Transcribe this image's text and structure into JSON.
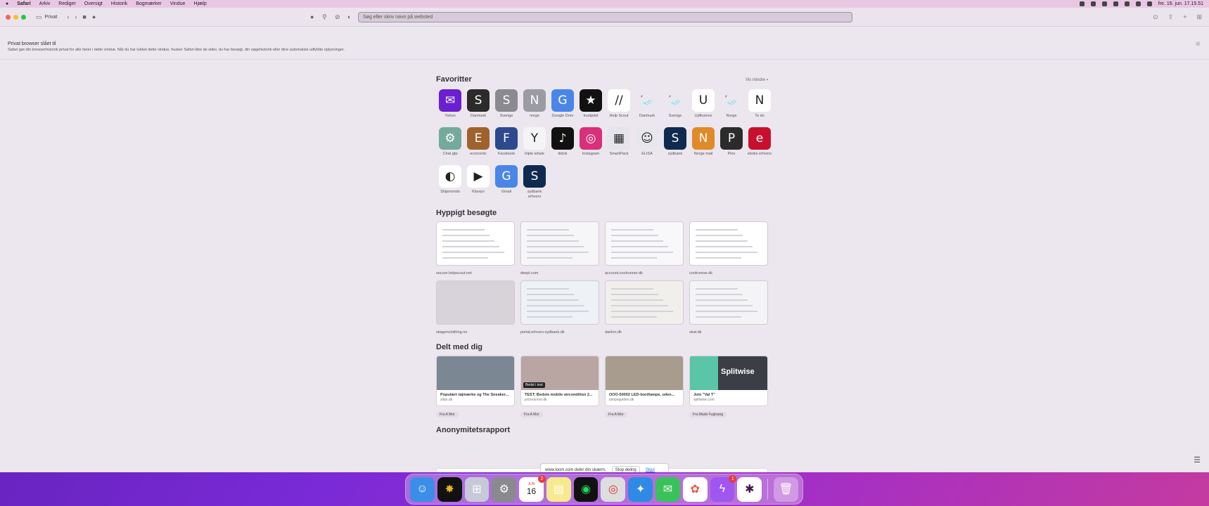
{
  "menubar": {
    "items": [
      "Safari",
      "Arkiv",
      "Rediger",
      "Oversigt",
      "Historik",
      "Bogmærker",
      "Vindue",
      "Hjælp"
    ],
    "clock": "fre. 16. jun. 17.15.51"
  },
  "toolbar": {
    "tab_label": "Privat",
    "address_placeholder": "Søg eller skriv navn på websted"
  },
  "private_banner": {
    "title": "Privat browser slået til",
    "text": "Safari gør din browserhistorik privat for alle faner i dette vindue. Når du har lukket dette vindue, husker Safari ikke de sider, du har besøgt, din søgehistorik eller dine automatisk udfyldte oplysninger."
  },
  "favorites": {
    "title": "Favoritter",
    "show_less": "Vis mindre",
    "items": [
      {
        "label": "Yahoo",
        "glyph": "✉",
        "color": "#6a1fd0"
      },
      {
        "label": "Danmark",
        "glyph": "S",
        "color": "#2b2b2b"
      },
      {
        "label": "Sverige",
        "glyph": "S",
        "color": "#8a8a90"
      },
      {
        "label": "norge",
        "glyph": "N",
        "color": "#9b9ba3"
      },
      {
        "label": "Google Drev",
        "glyph": "G",
        "color": "#4a86e8"
      },
      {
        "label": "trustpilot",
        "glyph": "★",
        "color": "#111111"
      },
      {
        "label": "Help Scout",
        "glyph": "//",
        "color": "#ffffff"
      },
      {
        "label": "Danmark",
        "glyph": "🦢",
        "color": "#ece6ee"
      },
      {
        "label": "Sverige",
        "glyph": "🦢",
        "color": "#ece6ee"
      },
      {
        "label": "Upfluence",
        "glyph": "U",
        "color": "#ffffff"
      },
      {
        "label": "Norge",
        "glyph": "🦢",
        "color": "#ece6ee"
      },
      {
        "label": "To do",
        "glyph": "N",
        "color": "#ffffff"
      },
      {
        "label": "Chat gtp",
        "glyph": "⚙",
        "color": "#74aa9c"
      },
      {
        "label": "economic",
        "glyph": "E",
        "color": "#a0622d"
      },
      {
        "label": "Facebook",
        "glyph": "F",
        "color": "#2c4a8c"
      },
      {
        "label": "triple whale",
        "glyph": "Y",
        "color": "#f4f4f6"
      },
      {
        "label": "tiktok",
        "glyph": "♪",
        "color": "#111111"
      },
      {
        "label": "Instagram",
        "glyph": "◎",
        "color": "#d8307a"
      },
      {
        "label": "SmartPack",
        "glyph": "▦",
        "color": "#e4e4ea"
      },
      {
        "label": "ELISA",
        "glyph": "☺",
        "color": "#e8e8ec"
      },
      {
        "label": "sydbank",
        "glyph": "S",
        "color": "#0e2a4e"
      },
      {
        "label": "Norge mail",
        "glyph": "N",
        "color": "#e08a2a"
      },
      {
        "label": "Ples",
        "glyph": "P",
        "color": "#2b2b2b"
      },
      {
        "label": "eboks erhverv",
        "glyph": "e",
        "color": "#c8102e"
      },
      {
        "label": "Shipmondo",
        "glyph": "◐",
        "color": "#ffffff"
      },
      {
        "label": "Klaviyo",
        "glyph": "▶",
        "color": "#ffffff"
      },
      {
        "label": "Gmail",
        "glyph": "G",
        "color": "#4a86e8"
      },
      {
        "label": "sydbank erhverv",
        "glyph": "S",
        "color": "#0e2a4e"
      }
    ]
  },
  "frequent": {
    "title": "Hyppigt besøgte",
    "items": [
      {
        "label": "secure.helpscout.net",
        "bg": "#ffffff"
      },
      {
        "label": "deepl.com",
        "bg": "#f6f6f8"
      },
      {
        "label": "account.coolrunner.dk",
        "bg": "#f8f8fa"
      },
      {
        "label": "coolrunner.dk",
        "bg": "#ffffff"
      },
      {
        "label": "skagenclothing.no",
        "bg": "#d7d3d8"
      },
      {
        "label": "portal.erhverv.sydbank.dk",
        "bg": "#eef1f5"
      },
      {
        "label": "danlon.dk",
        "bg": "#f1efec"
      },
      {
        "label": "skat.dk",
        "bg": "#f4f4f6"
      }
    ]
  },
  "shared": {
    "title": "Delt med dig",
    "items": [
      {
        "title": "Populært tøjmærke og The Sneaker...",
        "site": "zitan.dk",
        "from": "Fra A Mor",
        "bg": "#7c8794"
      },
      {
        "title": "TEST: Bedste mobile aircondition 2...",
        "site": "pricerunner.dk",
        "from": "Fra A Mor",
        "bg": "#b9a6a2",
        "tag": "Bedst i test"
      },
      {
        "title": "OOO-50002 LED-bordlampe, uden...",
        "site": "lampeguiden.dk",
        "from": "Fra A Mor",
        "bg": "#a89c8e"
      },
      {
        "title": "Join \"Val T\"",
        "site": "splitwise.com",
        "from": "Fra Mads Fuglsang",
        "bg": "#3b3f45",
        "brand": "Splitwise"
      }
    ]
  },
  "anonymity": {
    "title": "Anonymitetsrapport"
  },
  "loom_bar": {
    "text": "www.loom.com deler din skærm.",
    "stop": "Stop deling",
    "hide": "Skjul"
  },
  "dock": {
    "calendar_month": "JUN",
    "calendar_day": "16",
    "calendar_badge": "2",
    "messenger_badge": "1"
  }
}
